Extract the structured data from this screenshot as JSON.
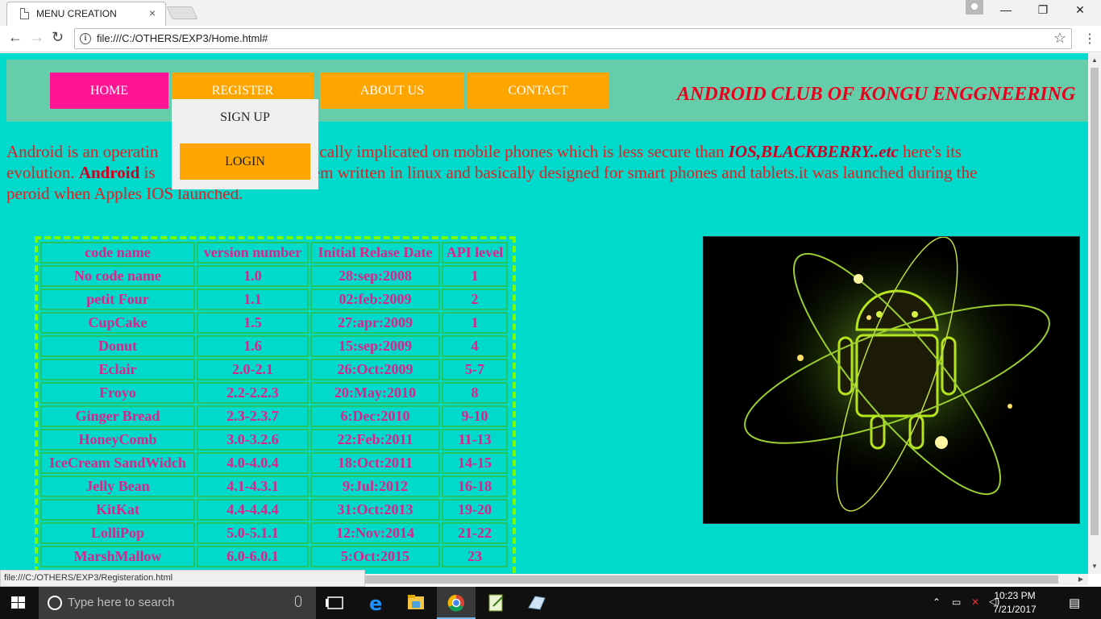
{
  "browser": {
    "tab_title": "MENU CREATION",
    "tab_close": "×",
    "url": "file:///C:/OTHERS/EXP3/Home.html#",
    "status_url": "file:///C:/OTHERS/EXP3/Registeration.html",
    "nav_back": "←",
    "nav_forward": "→",
    "nav_reload": "↻",
    "star": "☆",
    "menu": "⋮",
    "info": "i",
    "window_minimize": "—",
    "window_restore": "❐",
    "window_close": "✕"
  },
  "page": {
    "nav": {
      "home": "HOME",
      "register": "REGISTER",
      "about": "ABOUT US",
      "contact": "CONTACT"
    },
    "dropdown": {
      "signup": "SIGN UP",
      "login": "LOGIN"
    },
    "club_title": "ANDROID CLUB OF KONGU ENGGNEERING",
    "intro": {
      "p1": "Android is an operatin",
      "p2": "cally implicated on mobile phones which is less secure than ",
      "ios": "IOS,BLACKBERRY..etc",
      "p3": " here's its",
      "p4": "evolution. ",
      "android": "Android",
      "p5": " is ",
      "p6": "em written in linux and basically designed for smart phones and tablets.it was launched during the",
      "p7": "peroid when Apples IOS launched."
    },
    "table": {
      "headers": [
        "code name",
        "version number",
        "Initial Relase Date",
        "API level"
      ],
      "rows": [
        [
          "No code name",
          "1.0",
          "28:sep:2008",
          "1"
        ],
        [
          "petit Four",
          "1.1",
          "02:feb:2009",
          "2"
        ],
        [
          "CupCake",
          "1.5",
          "27:apr:2009",
          "1"
        ],
        [
          "Donut",
          "1.6",
          "15:sep:2009",
          "4"
        ],
        [
          "Eclair",
          "2.0-2.1",
          "26:Oct:2009",
          "5-7"
        ],
        [
          "Froyo",
          "2.2-2.2.3",
          "20:May:2010",
          "8"
        ],
        [
          "Ginger Bread",
          "2.3-2.3.7",
          "6:Dec:2010",
          "9-10"
        ],
        [
          "HoneyComb",
          "3.0-3.2.6",
          "22:Feb:2011",
          "11-13"
        ],
        [
          "IceCream SandWidch",
          "4.0-4.0.4",
          "18:Oct:2011",
          "14-15"
        ],
        [
          "Jelly Bean",
          "4.1-4.3.1",
          "9:Jul:2012",
          "16-18"
        ],
        [
          "KitKat",
          "4.4-4.4.4",
          "31:Oct:2013",
          "19-20"
        ],
        [
          "LolliPop",
          "5.0-5.1.1",
          "12:Nov:2014",
          "21-22"
        ],
        [
          "MarshMallow",
          "6.0-6.0.1",
          "5:Oct:2015",
          "23"
        ]
      ]
    },
    "colors": {
      "background": "#00dacc",
      "navbar": "#66cdaa",
      "home_button": "#ff1493",
      "menu_button": "#ffa500",
      "title_red": "#e8001c",
      "table_text": "#e0218a",
      "table_border": "#7cfc00"
    }
  },
  "taskbar": {
    "search_placeholder": "Type here to search",
    "time": "10:23 PM",
    "date": "7/21/2017"
  }
}
